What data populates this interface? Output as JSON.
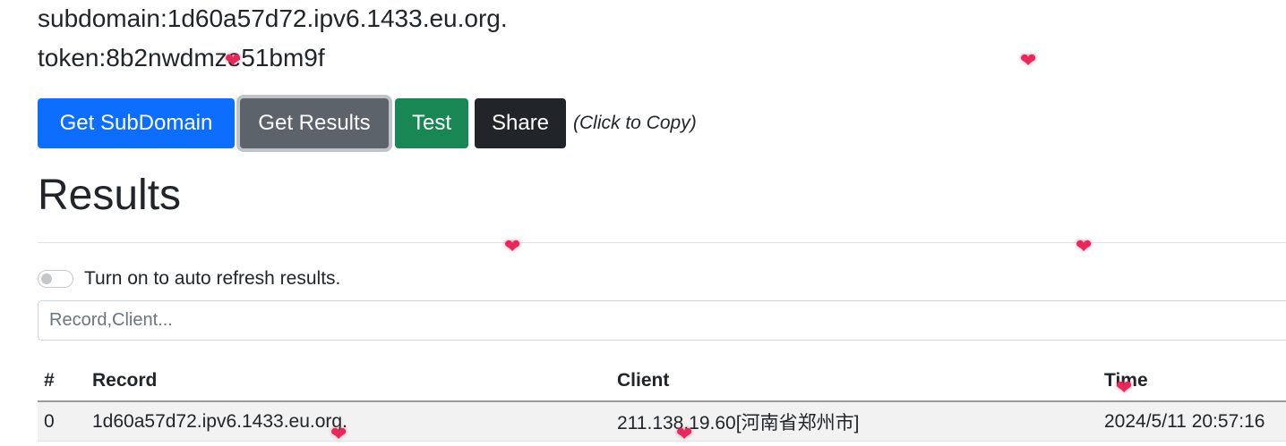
{
  "info": {
    "subdomain_line": "subdomain:1d60a57d72.ipv6.1433.eu.org.",
    "token_line": "token:8b2nwdmze51bm9f"
  },
  "buttons": {
    "get_subdomain": "Get SubDomain",
    "get_results": "Get Results",
    "test": "Test",
    "share": "Share",
    "copy_hint": "(Click to Copy)"
  },
  "results": {
    "title": "Results",
    "auto_refresh_label": "Turn on to auto refresh results.",
    "auto_refresh_on": false,
    "search_placeholder": "Record,Client...",
    "search_value": "",
    "columns": {
      "num": "#",
      "record": "Record",
      "client": "Client",
      "time": "Time"
    },
    "rows": [
      {
        "num": "0",
        "record": "1d60a57d72.ipv6.1433.eu.org.",
        "client": "211.138.19.60[河南省郑州市]",
        "time": "2024/5/11 20:57:16"
      }
    ]
  },
  "colors": {
    "primary": "#0d6efd",
    "secondary": "#5c636a",
    "success": "#198754",
    "dark": "#212529",
    "heart": "#e8285a"
  },
  "decorations": {
    "heart_icon": "heart-icon",
    "heart_glyph": "❤"
  }
}
